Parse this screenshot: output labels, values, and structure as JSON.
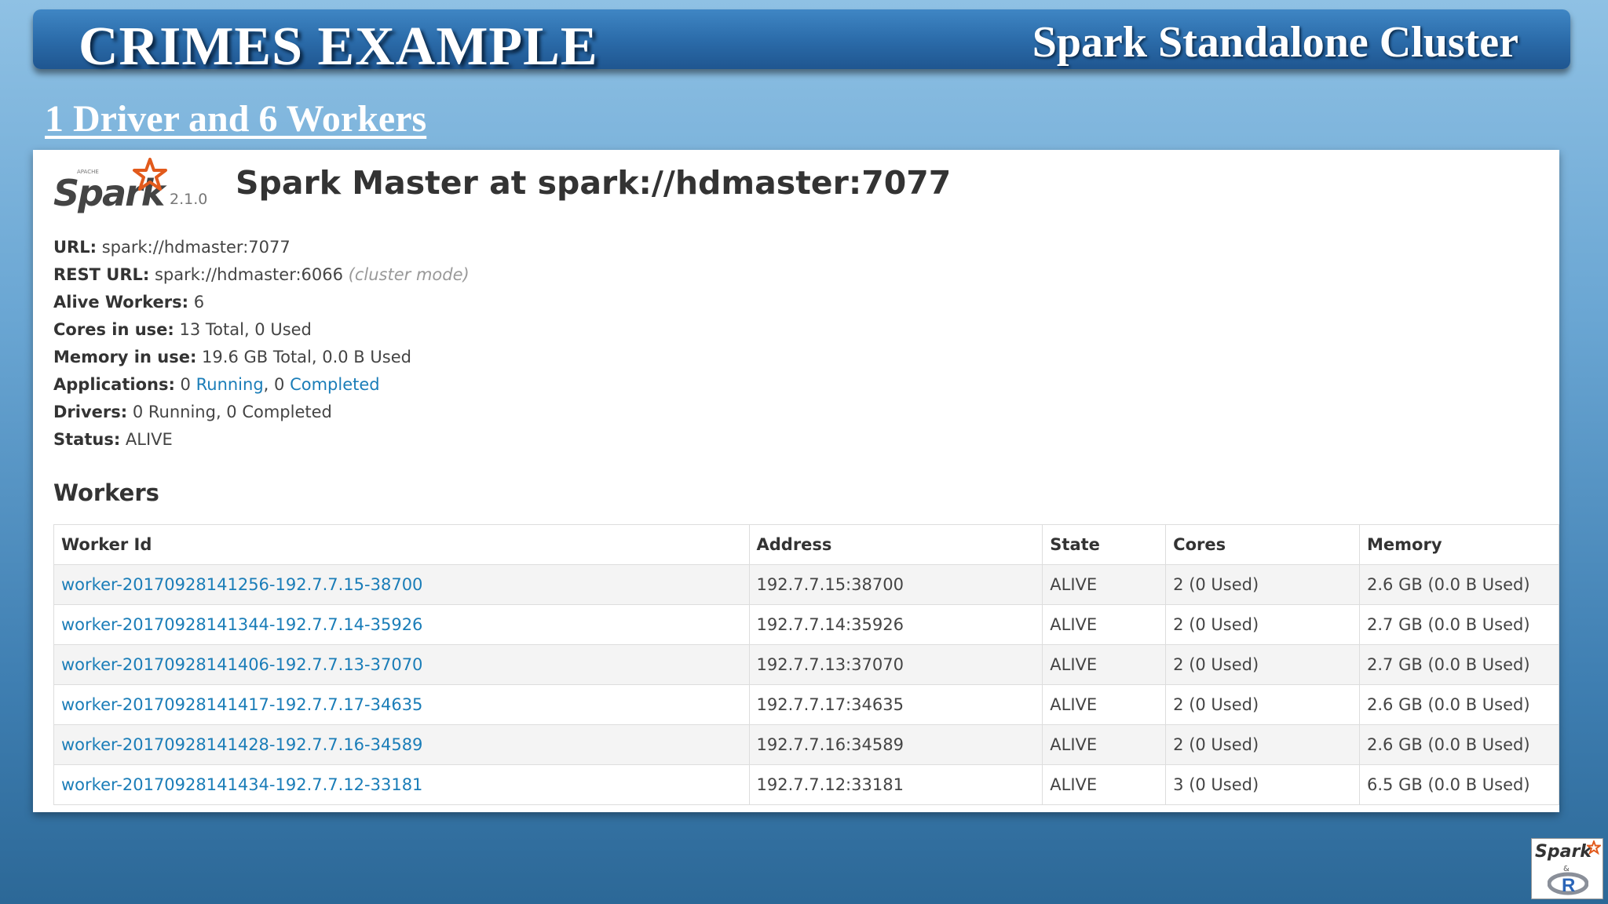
{
  "slide": {
    "title": "CRIMES EXAMPLE",
    "subtitle": "Spark Standalone Cluster",
    "section_heading": "1 Driver and 6 Workers"
  },
  "spark_ui": {
    "logo_icon": "spark-logo",
    "logo_text": "Spark",
    "version": "2.1.0",
    "master_title": "Spark Master at spark://hdmaster:7077",
    "info": {
      "url_label": "URL:",
      "url_value": "spark://hdmaster:7077",
      "rest_url_label": "REST URL:",
      "rest_url_value": "spark://hdmaster:6066",
      "rest_url_note": "(cluster mode)",
      "alive_workers_label": "Alive Workers:",
      "alive_workers_value": "6",
      "cores_label": "Cores in use:",
      "cores_value": "13 Total, 0 Used",
      "memory_label": "Memory in use:",
      "memory_value": "19.6 GB Total, 0.0 B Used",
      "applications_label": "Applications:",
      "applications_running_count": "0",
      "applications_running_link": "Running",
      "applications_sep": ", 0",
      "applications_completed_link": "Completed",
      "drivers_label": "Drivers:",
      "drivers_value": "0 Running, 0 Completed",
      "status_label": "Status:",
      "status_value": "ALIVE"
    },
    "workers_heading": "Workers",
    "table": {
      "headers": [
        "Worker Id",
        "Address",
        "State",
        "Cores",
        "Memory"
      ],
      "rows": [
        [
          "worker-20170928141256-192.7.7.15-38700",
          "192.7.7.15:38700",
          "ALIVE",
          "2 (0 Used)",
          "2.6 GB (0.0 B Used)"
        ],
        [
          "worker-20170928141344-192.7.7.14-35926",
          "192.7.7.14:35926",
          "ALIVE",
          "2 (0 Used)",
          "2.7 GB (0.0 B Used)"
        ],
        [
          "worker-20170928141406-192.7.7.13-37070",
          "192.7.7.13:37070",
          "ALIVE",
          "2 (0 Used)",
          "2.7 GB (0.0 B Used)"
        ],
        [
          "worker-20170928141417-192.7.7.17-34635",
          "192.7.7.17:34635",
          "ALIVE",
          "2 (0 Used)",
          "2.6 GB (0.0 B Used)"
        ],
        [
          "worker-20170928141428-192.7.7.16-34589",
          "192.7.7.16:34589",
          "ALIVE",
          "2 (0 Used)",
          "2.6 GB (0.0 B Used)"
        ],
        [
          "worker-20170928141434-192.7.7.12-33181",
          "192.7.7.12:33181",
          "ALIVE",
          "3 (0 Used)",
          "6.5 GB (0.0 B Used)"
        ]
      ]
    }
  },
  "corner_logo": {
    "text": "Spark",
    "amp": "&",
    "icon": "r-logo"
  },
  "colors": {
    "link": "#1a7db8",
    "spark_star": "#e25a1c",
    "header_bar": "#2a6aa8"
  }
}
